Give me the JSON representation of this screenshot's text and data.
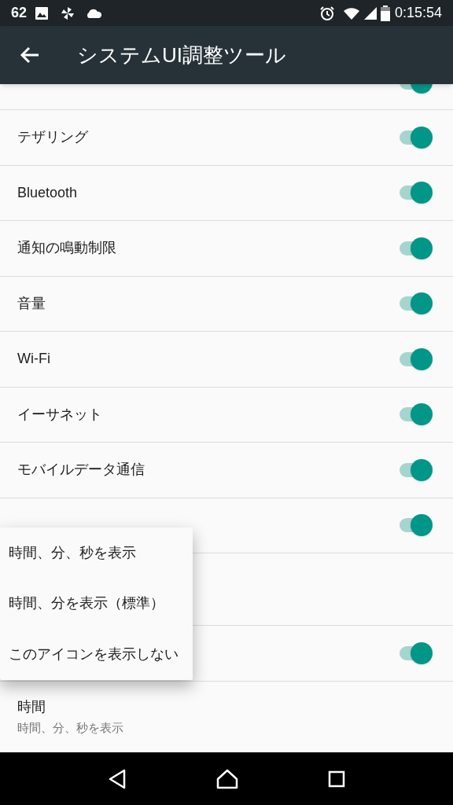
{
  "status_bar": {
    "count": "62",
    "time": "0:15:54"
  },
  "app_bar": {
    "title": "システムUI調整ツール"
  },
  "settings": [
    {
      "kind": "toggle",
      "on": true
    },
    {
      "kind": "toggle",
      "label": "テザリング",
      "on": true
    },
    {
      "kind": "toggle",
      "label": "Bluetooth",
      "on": true
    },
    {
      "kind": "toggle",
      "label": "通知の鳴動制限",
      "on": true
    },
    {
      "kind": "toggle",
      "label": "音量",
      "on": true
    },
    {
      "kind": "toggle",
      "label": "Wi-Fi",
      "on": true
    },
    {
      "kind": "toggle",
      "label": "イーサネット",
      "on": true
    },
    {
      "kind": "toggle",
      "label": "モバイルデータ通信",
      "on": true
    },
    {
      "kind": "toggle",
      "on": true
    },
    {
      "kind": "covered"
    },
    {
      "kind": "toggle",
      "on": true
    },
    {
      "kind": "detail",
      "label": "時間",
      "summary": "時間、分、秒を表示"
    }
  ],
  "popup_menu": {
    "items": [
      "時間、分、秒を表示",
      "時間、分を表示（標準）",
      "このアイコンを表示しない"
    ]
  }
}
